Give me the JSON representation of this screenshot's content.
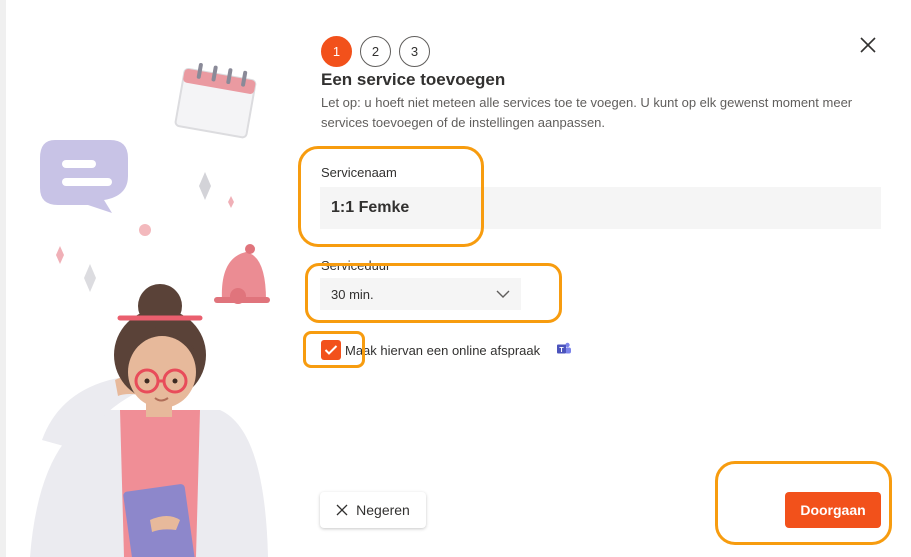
{
  "steps": [
    "1",
    "2",
    "3"
  ],
  "active_step": 1,
  "dialog": {
    "title": "Een service toevoegen",
    "description": "Let op: u hoeft niet meteen alle services toe te voegen. U kunt op elk gewenst moment meer services toevoegen of de instellingen aanpassen."
  },
  "form": {
    "service_name_label": "Servicenaam",
    "service_name_value": "1:1 Femke",
    "duration_label": "Serviceduur",
    "duration_value": "30 min.",
    "online_meeting_label": "Maak hiervan een online afspraak",
    "online_meeting_checked": true
  },
  "buttons": {
    "dismiss_label": "Negeren",
    "continue_label": "Doorgaan"
  },
  "icons": [
    "close-icon",
    "chevron-down-icon",
    "checkmark-icon",
    "teams-icon",
    "dismiss-icon"
  ],
  "colors": {
    "accent": "#f2511b",
    "annotation": "#f79c0f",
    "input_background": "#f5f5f5"
  }
}
